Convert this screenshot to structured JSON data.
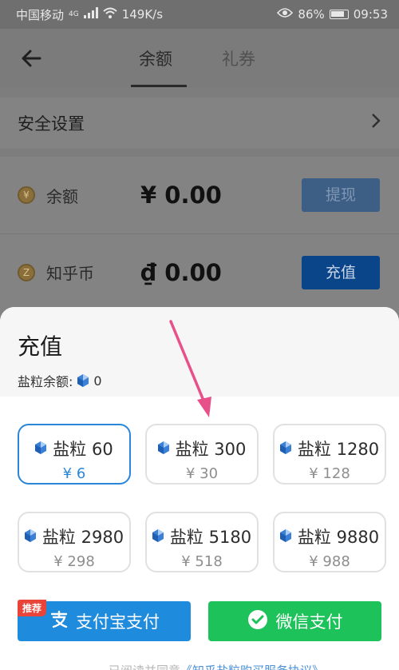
{
  "status_bar": {
    "carrier": "中国移动",
    "network": "4G",
    "speed": "149K/s",
    "battery": "86%",
    "time": "09:53"
  },
  "nav": {
    "tabs": [
      {
        "label": "余额",
        "active": true
      },
      {
        "label": "礼券",
        "active": false
      }
    ]
  },
  "security": {
    "label": "安全设置"
  },
  "wallet": {
    "balance": {
      "label": "余额",
      "amount": "¥ 0.00",
      "action": "提现"
    },
    "coins": {
      "label": "知乎币",
      "amount": "₫ 0.00",
      "action": "充值"
    }
  },
  "sheet": {
    "title": "充值",
    "balance_label": "盐粒余额:",
    "balance_value": "0",
    "packages": [
      {
        "name": "盐粒 60",
        "price": "¥ 6",
        "selected": true
      },
      {
        "name": "盐粒 300",
        "price": "¥ 30",
        "selected": false
      },
      {
        "name": "盐粒 1280",
        "price": "¥ 128",
        "selected": false
      },
      {
        "name": "盐粒 2980",
        "price": "¥ 298",
        "selected": false
      },
      {
        "name": "盐粒 5180",
        "price": "¥ 518",
        "selected": false
      },
      {
        "name": "盐粒 9880",
        "price": "¥ 988",
        "selected": false
      }
    ],
    "alipay": {
      "badge": "推荐",
      "label": "支付宝支付"
    },
    "wechat": {
      "label": "微信支付"
    },
    "agreement_prefix": "已阅读并同意",
    "agreement_link": "《知乎盐粒购买服务协议》"
  },
  "colors": {
    "accent": "#2a86d8",
    "alipay": "#1f8bdc",
    "wechat": "#1ec25a",
    "annotation_arrow": "#e8508a"
  }
}
